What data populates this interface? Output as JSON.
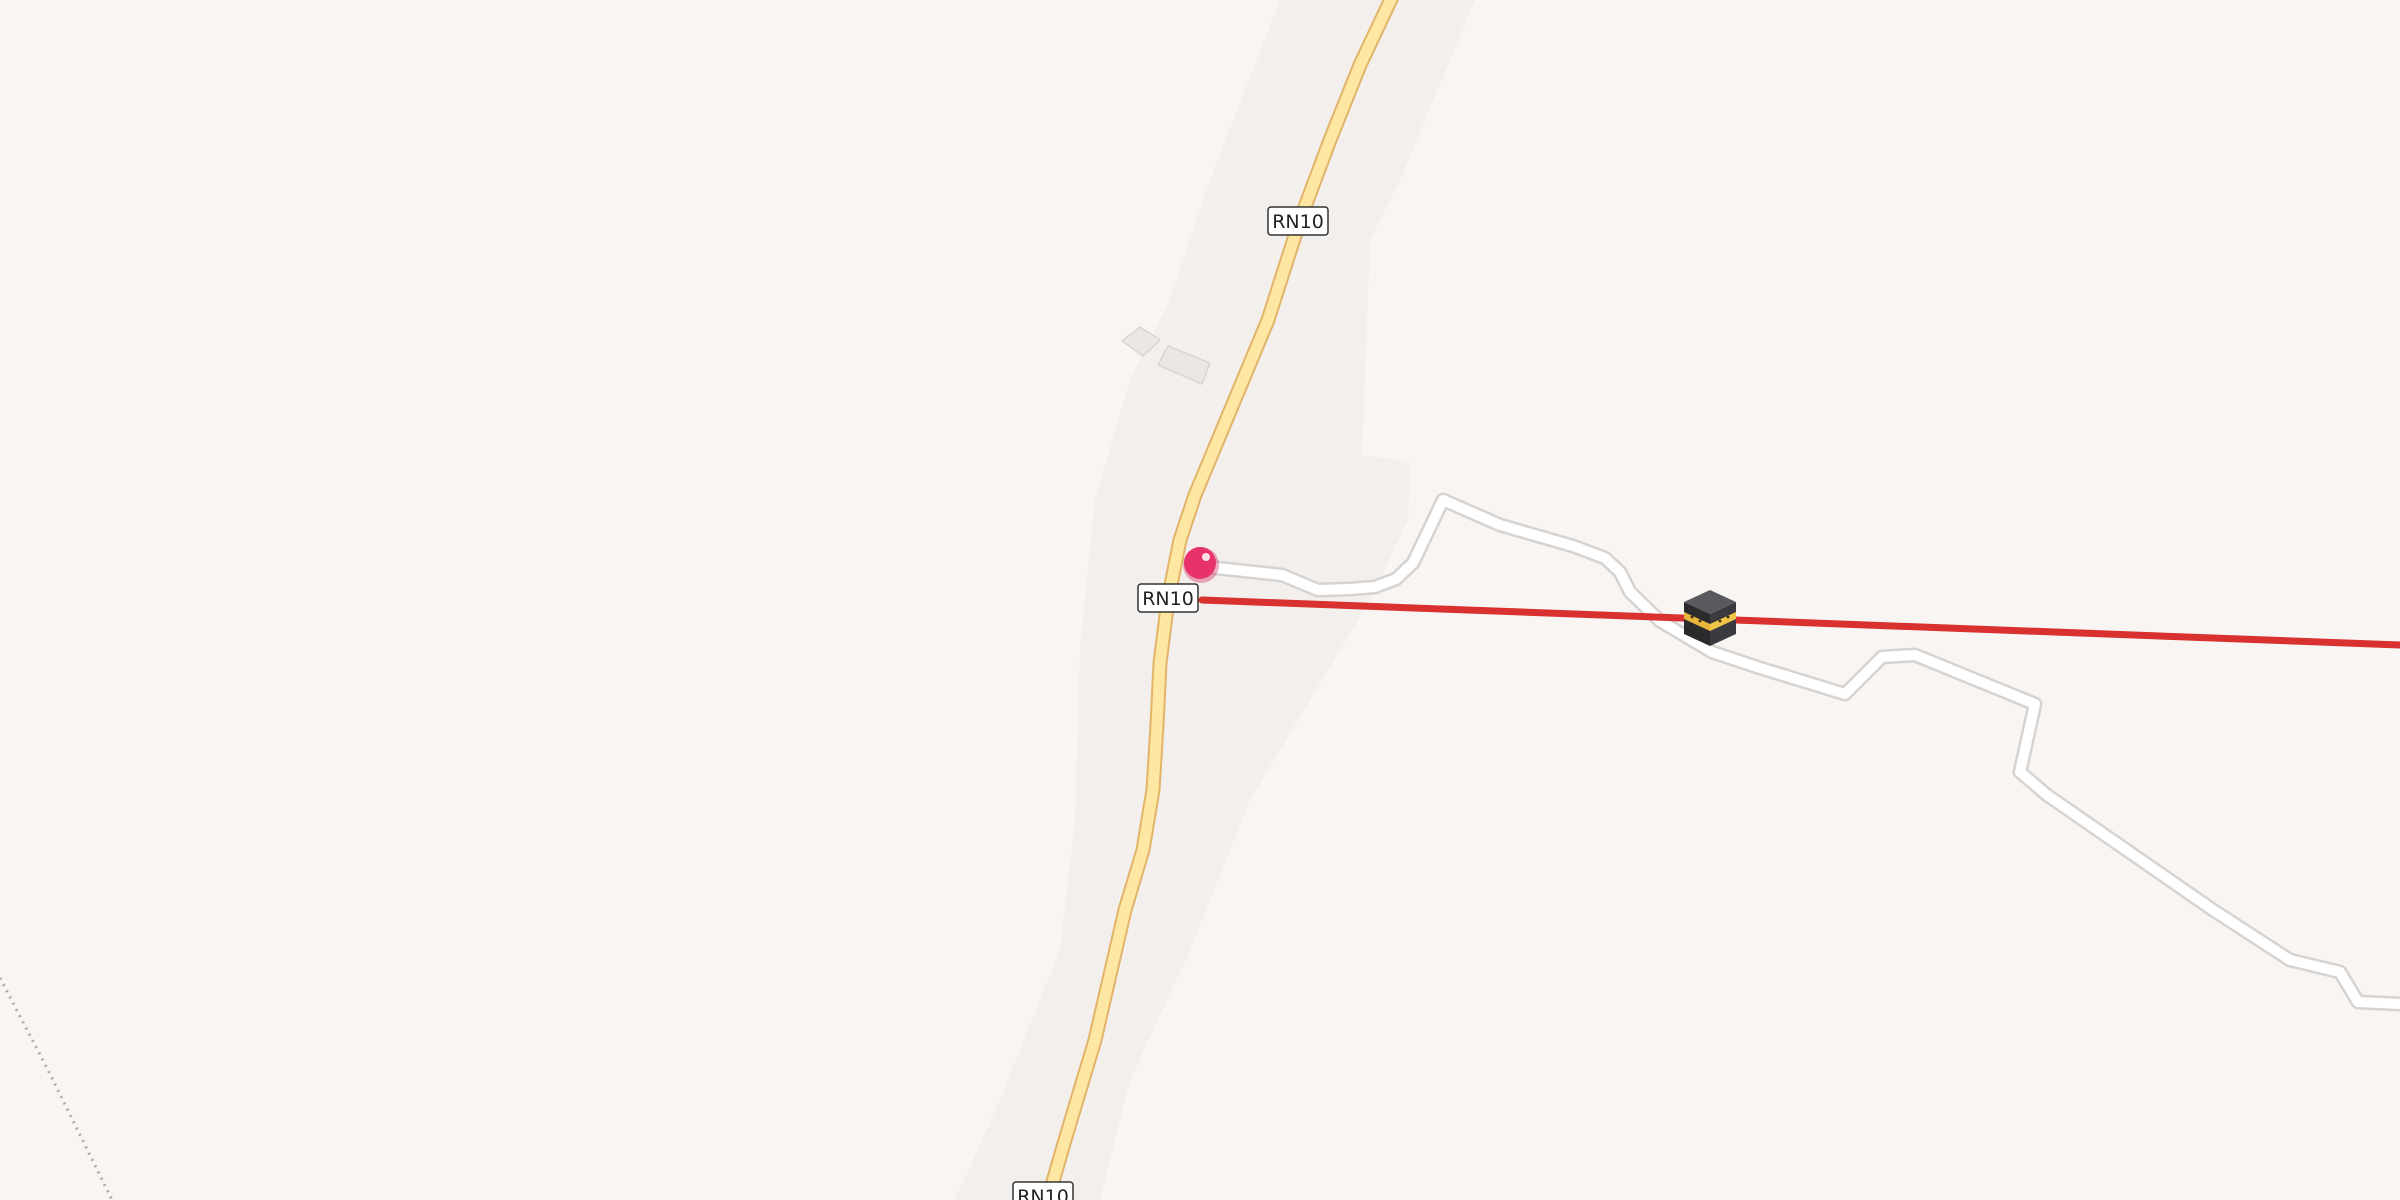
{
  "map": {
    "colors": {
      "background": "#f8f5f2",
      "landuse": "#f3efec",
      "primary_road_fill": "#fde7a3",
      "primary_road_casing": "#e2b469",
      "minor_road_fill": "#ffffff",
      "minor_road_casing": "#d6d3d1",
      "route_line": "#d93030",
      "building": "#ece7e2",
      "building_stroke": "#dcd5cf",
      "pin": "#e8336a",
      "dotted_boundary": "#b5a9ab"
    },
    "road_labels": [
      {
        "text": "RN10"
      },
      {
        "text": "RN10"
      },
      {
        "text": "RN10"
      }
    ],
    "markers": {
      "location_pin": {
        "icon": "map-pin-icon"
      },
      "poi": {
        "icon": "kaaba-icon",
        "kind": "place of worship"
      }
    }
  }
}
